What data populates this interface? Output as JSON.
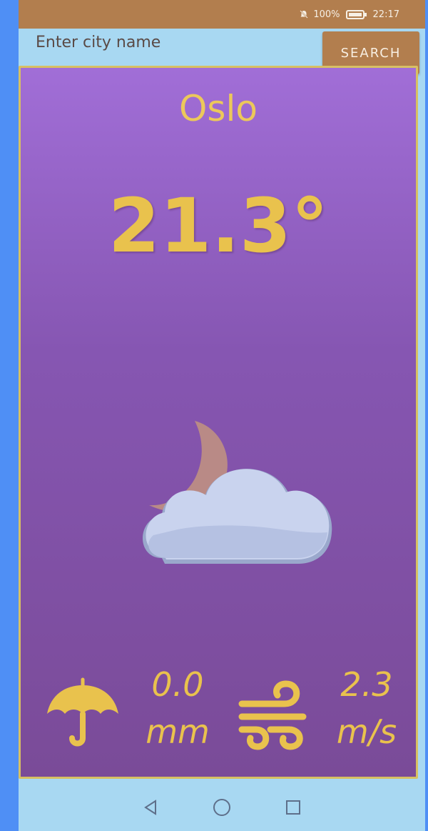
{
  "status_bar": {
    "battery": "100%",
    "time": "22:17",
    "icons": [
      "mute-icon",
      "battery-icon"
    ]
  },
  "search": {
    "placeholder": "Enter city name",
    "button_label": "SEARCH"
  },
  "weather": {
    "city": "Oslo",
    "temperature": "21.3°",
    "condition_icon": "moon-cloud-icon",
    "precipitation": {
      "value": "0.0",
      "unit": "mm",
      "icon": "umbrella-icon"
    },
    "wind": {
      "value": "2.3",
      "unit": "m/s",
      "icon": "wind-icon"
    }
  },
  "navigation": {
    "buttons": [
      "back-icon",
      "home-icon",
      "recents-icon"
    ]
  },
  "colors": {
    "status_bar": "#b27e4e",
    "card_top": "#a16ed7",
    "card_bottom": "#7a4b98",
    "accent_text": "#e9c24d",
    "card_border": "#d7c063",
    "background": "#a8d8f2"
  }
}
